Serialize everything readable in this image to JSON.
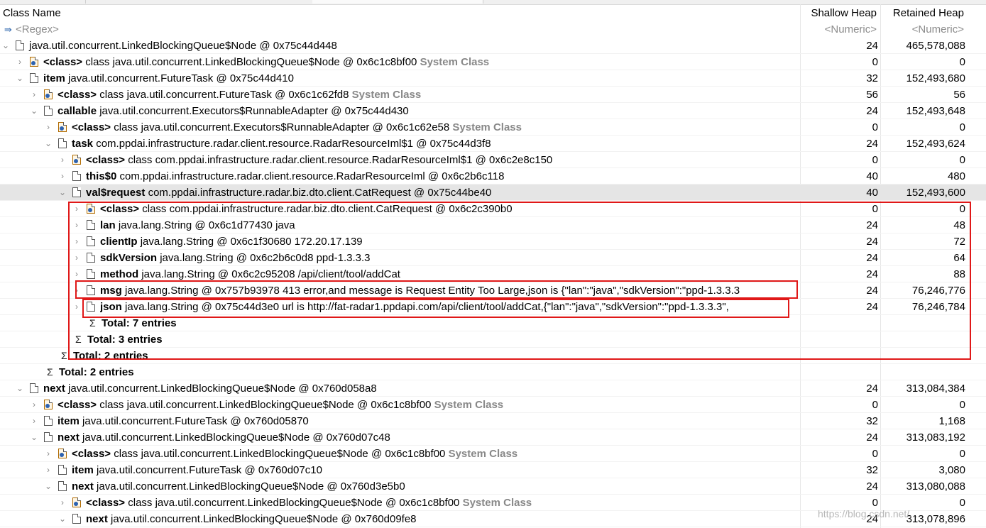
{
  "columns": {
    "class_name": "Class Name",
    "shallow_heap": "Shallow Heap",
    "retained_heap": "Retained Heap"
  },
  "filters": {
    "regex": "<Regex>",
    "numeric1": "<Numeric>",
    "numeric2": "<Numeric>"
  },
  "rows": [
    {
      "field": "",
      "text": "java.util.concurrent.LinkedBlockingQueue$Node @ 0x75c44d448",
      "system": "",
      "shallow": "24",
      "retained": "465,578,088"
    },
    {
      "field": "<class>",
      "text": "class java.util.concurrent.LinkedBlockingQueue$Node @ 0x6c1c8bf00",
      "system": "System Class",
      "shallow": "0",
      "retained": "0"
    },
    {
      "field": "item",
      "text": "java.util.concurrent.FutureTask @ 0x75c44d410",
      "system": "",
      "shallow": "32",
      "retained": "152,493,680"
    },
    {
      "field": "<class>",
      "text": "class java.util.concurrent.FutureTask @ 0x6c1c62fd8",
      "system": "System Class",
      "shallow": "56",
      "retained": "56"
    },
    {
      "field": "callable",
      "text": "java.util.concurrent.Executors$RunnableAdapter @ 0x75c44d430",
      "system": "",
      "shallow": "24",
      "retained": "152,493,648"
    },
    {
      "field": "<class>",
      "text": "class java.util.concurrent.Executors$RunnableAdapter @ 0x6c1c62e58",
      "system": "System Class",
      "shallow": "0",
      "retained": "0"
    },
    {
      "field": "task",
      "text": "com.ppdai.infrastructure.radar.client.resource.RadarResourceIml$1 @ 0x75c44d3f8",
      "system": "",
      "shallow": "24",
      "retained": "152,493,624"
    },
    {
      "field": "<class>",
      "text": "class com.ppdai.infrastructure.radar.client.resource.RadarResourceIml$1 @ 0x6c2e8c150",
      "system": "",
      "shallow": "0",
      "retained": "0"
    },
    {
      "field": "this$0",
      "text": "com.ppdai.infrastructure.radar.client.resource.RadarResourceIml @ 0x6c2b6c118",
      "system": "",
      "shallow": "40",
      "retained": "480"
    },
    {
      "field": "val$request",
      "text": "com.ppdai.infrastructure.radar.biz.dto.client.CatRequest @ 0x75c44be40",
      "system": "",
      "shallow": "40",
      "retained": "152,493,600"
    },
    {
      "field": "<class>",
      "text": "class com.ppdai.infrastructure.radar.biz.dto.client.CatRequest @ 0x6c2c390b0",
      "system": "",
      "shallow": "0",
      "retained": "0"
    },
    {
      "field": "lan",
      "text": "java.lang.String @ 0x6c1d77430  java",
      "system": "",
      "shallow": "24",
      "retained": "48"
    },
    {
      "field": "clientIp",
      "text": "java.lang.String @ 0x6c1f30680  172.20.17.139",
      "system": "",
      "shallow": "24",
      "retained": "72"
    },
    {
      "field": "sdkVersion",
      "text": "java.lang.String @ 0x6c2b6c0d8  ppd-1.3.3.3",
      "system": "",
      "shallow": "24",
      "retained": "64"
    },
    {
      "field": "method",
      "text": "java.lang.String @ 0x6c2c95208  /api/client/tool/addCat",
      "system": "",
      "shallow": "24",
      "retained": "88"
    },
    {
      "field": "msg",
      "text": "java.lang.String @ 0x757b93978  413 error,and message is Request Entity Too Large,json is {\"lan\":\"java\",\"sdkVersion\":\"ppd-1.3.3.3",
      "system": "",
      "shallow": "24",
      "retained": "76,246,776"
    },
    {
      "field": "json",
      "text": "java.lang.String @ 0x75c44d3e0  url is http://fat-radar1.ppdapi.com/api/client/tool/addCat,{\"lan\":\"java\",\"sdkVersion\":\"ppd-1.3.3.3\",",
      "system": "",
      "shallow": "24",
      "retained": "76,246,784"
    },
    {
      "field": "",
      "text": "Total: 7 entries",
      "system": "",
      "shallow": "",
      "retained": ""
    },
    {
      "field": "",
      "text": "Total: 3 entries",
      "system": "",
      "shallow": "",
      "retained": ""
    },
    {
      "field": "",
      "text": "Total: 2 entries",
      "system": "",
      "shallow": "",
      "retained": ""
    },
    {
      "field": "",
      "text": "Total: 2 entries",
      "system": "",
      "shallow": "",
      "retained": ""
    },
    {
      "field": "next",
      "text": "java.util.concurrent.LinkedBlockingQueue$Node @ 0x760d058a8",
      "system": "",
      "shallow": "24",
      "retained": "313,084,384"
    },
    {
      "field": "<class>",
      "text": "class java.util.concurrent.LinkedBlockingQueue$Node @ 0x6c1c8bf00",
      "system": "System Class",
      "shallow": "0",
      "retained": "0"
    },
    {
      "field": "item",
      "text": "java.util.concurrent.FutureTask @ 0x760d05870",
      "system": "",
      "shallow": "32",
      "retained": "1,168"
    },
    {
      "field": "next",
      "text": "java.util.concurrent.LinkedBlockingQueue$Node @ 0x760d07c48",
      "system": "",
      "shallow": "24",
      "retained": "313,083,192"
    },
    {
      "field": "<class>",
      "text": "class java.util.concurrent.LinkedBlockingQueue$Node @ 0x6c1c8bf00",
      "system": "System Class",
      "shallow": "0",
      "retained": "0"
    },
    {
      "field": "item",
      "text": "java.util.concurrent.FutureTask @ 0x760d07c10",
      "system": "",
      "shallow": "32",
      "retained": "3,080"
    },
    {
      "field": "next",
      "text": "java.util.concurrent.LinkedBlockingQueue$Node @ 0x760d3e5b0",
      "system": "",
      "shallow": "24",
      "retained": "313,080,088"
    },
    {
      "field": "<class>",
      "text": "class java.util.concurrent.LinkedBlockingQueue$Node @ 0x6c1c8bf00",
      "system": "System Class",
      "shallow": "0",
      "retained": "0"
    },
    {
      "field": "next",
      "text": "java.util.concurrent.LinkedBlockingQueue$Node @ 0x760d09fe8",
      "system": "",
      "shallow": "24",
      "retained": "313,078,896"
    }
  ],
  "watermark": "https://blog.csdn.net/..."
}
